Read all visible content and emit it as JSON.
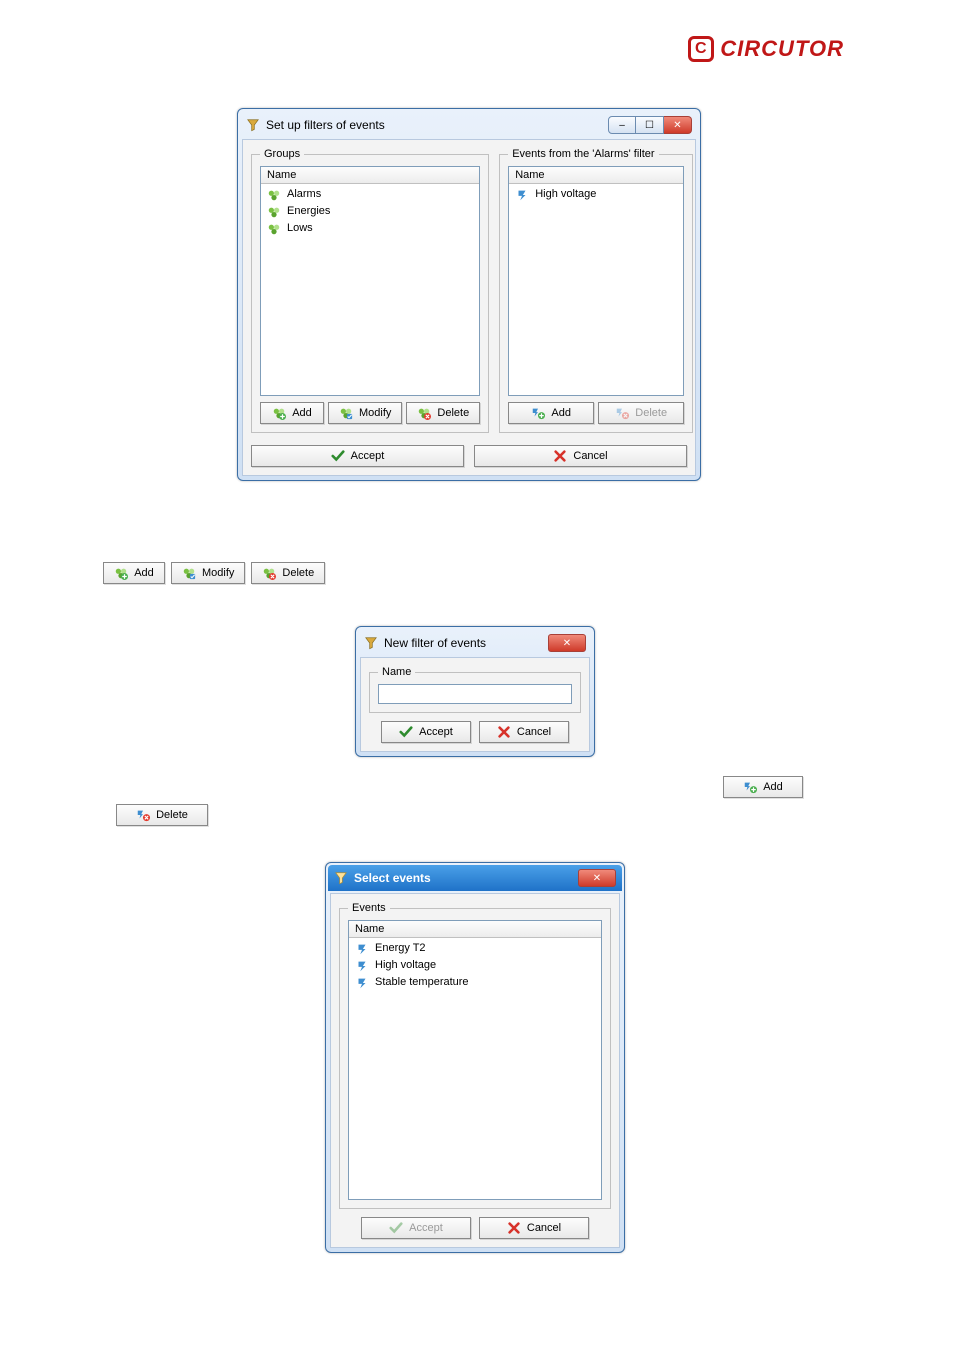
{
  "logo_text": "CIRCUTOR",
  "main_window": {
    "title": "Set up filters of events",
    "groups_legend": "Groups",
    "groups_header": "Name",
    "groups_items": [
      "Alarms",
      "Energies",
      "Lows"
    ],
    "events_legend": "Events from the 'Alarms' filter",
    "events_header": "Name",
    "events_items": [
      "High voltage"
    ],
    "btn_add": "Add",
    "btn_modify": "Modify",
    "btn_delete": "Delete",
    "btn_add_event": "Add",
    "btn_delete_event": "Delete",
    "btn_accept": "Accept",
    "btn_cancel": "Cancel"
  },
  "toolbar_buttons": {
    "add": "Add",
    "modify": "Modify",
    "delete": "Delete"
  },
  "new_filter": {
    "title": "New filter of events",
    "name_legend": "Name",
    "accept": "Accept",
    "cancel": "Cancel",
    "value": ""
  },
  "float_add": "Add",
  "float_delete": "Delete",
  "select_events": {
    "title": "Select events",
    "events_legend": "Events",
    "header": "Name",
    "items": [
      "Energy T2",
      "High voltage",
      "Stable temperature"
    ],
    "accept": "Accept",
    "cancel": "Cancel"
  }
}
